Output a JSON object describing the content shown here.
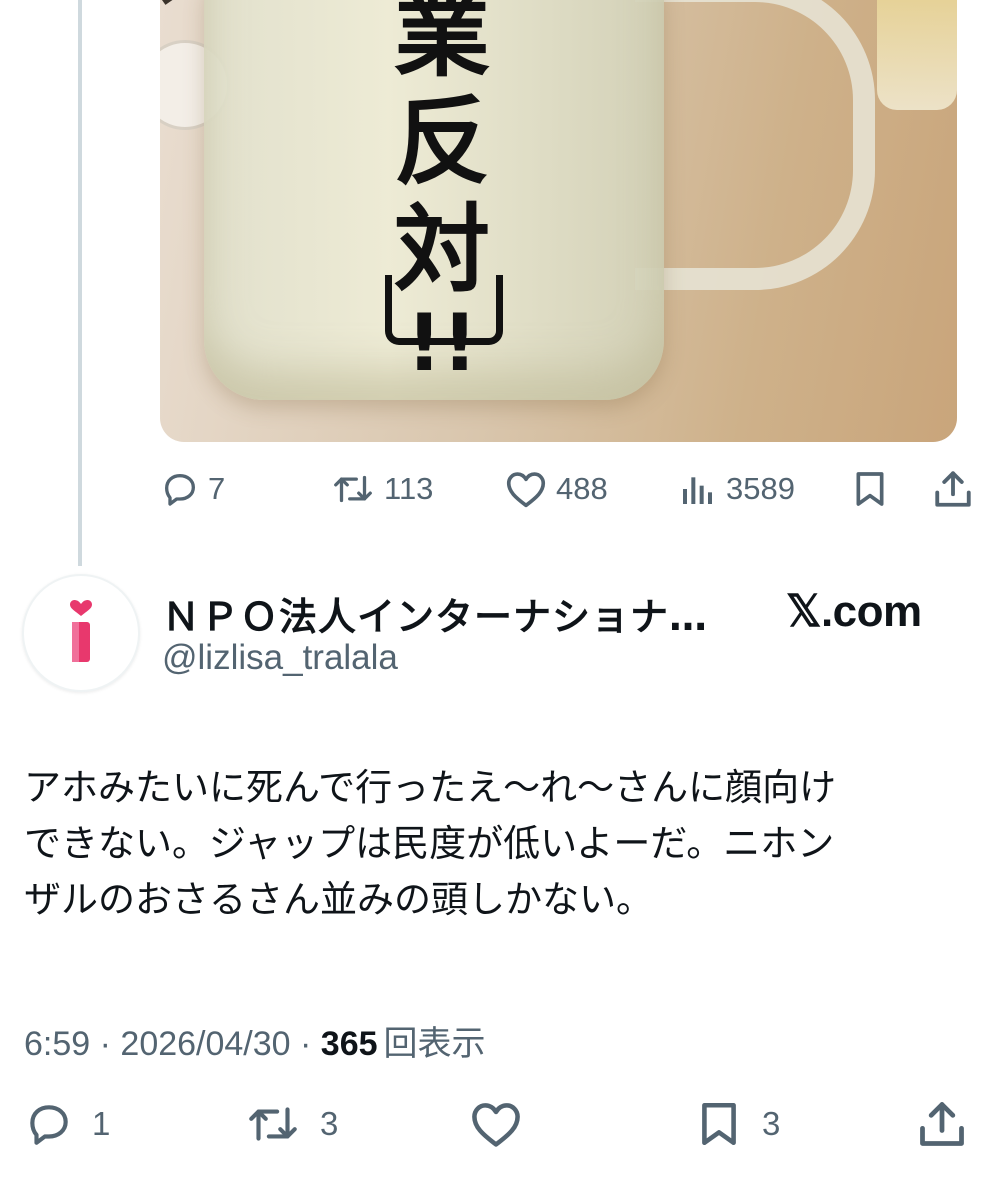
{
  "media": {
    "label_lines": [
      "業",
      "反",
      "対",
      "!!"
    ],
    "mute_icon": "muted-speaker-icon"
  },
  "quoted_actions": {
    "replies": "7",
    "reposts": "113",
    "likes": "488",
    "views": "3589",
    "icons": [
      "reply-icon",
      "repost-icon",
      "like-icon",
      "views-icon",
      "bookmark-icon",
      "share-icon"
    ]
  },
  "author": {
    "name": "ＮＰＯ法人インターナショナ…",
    "handle": "@lizlisa_tralala",
    "avatar_icon": "pink-heart-i-logo",
    "brand": "𝕏.com"
  },
  "post": {
    "lines": [
      "アホみたいに死んで行ったえ〜れ〜さんに顔向け",
      "できない。ジャップは民度が低いよーだ。ニホン",
      "ザルのおさるさん並みの頭しかない。"
    ]
  },
  "meta": {
    "time": "6:59",
    "sep1": " · ",
    "date": "2026/04/30",
    "sep2": " · ",
    "views_count": "365",
    "views_label": "回表示"
  },
  "actions": {
    "replies": "1",
    "reposts": "3",
    "bookmarks": "3",
    "icons": [
      "reply-icon",
      "repost-icon",
      "like-icon",
      "bookmark-icon",
      "share-icon"
    ]
  },
  "colors": {
    "text": "#0f1419",
    "secondary": "#536471",
    "thread_line": "#cfd9de",
    "avatar_pink": "#e8386d"
  }
}
